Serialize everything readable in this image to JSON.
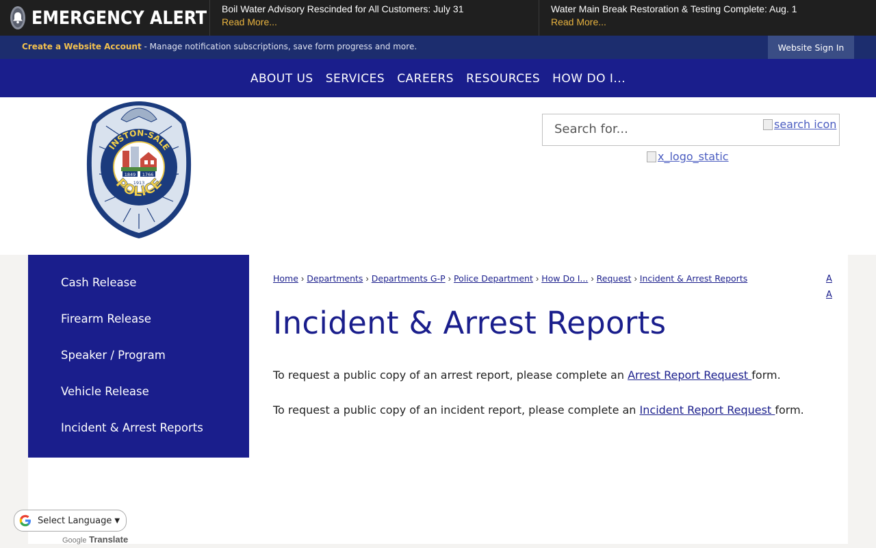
{
  "alert": {
    "title": "EMERGENCY ALERT",
    "items": [
      {
        "text": "Boil Water Advisory Rescinded for All Customers: July 31",
        "more": "Read More..."
      },
      {
        "text": "Water Main Break Restoration & Testing Complete: Aug. 1",
        "more": "Read More..."
      }
    ]
  },
  "account": {
    "create_link": "Create a Website Account",
    "description": " - Manage notification subscriptions, save form progress and more.",
    "signin": "Website Sign In"
  },
  "nav": {
    "items": [
      "ABOUT US",
      "SERVICES",
      "CAREERS",
      "RESOURCES",
      "HOW DO I..."
    ]
  },
  "header": {
    "badge": {
      "top_text": "WINSTON-SALEM",
      "bottom_text": "POLICE",
      "years": [
        "1849",
        "1766",
        "1913"
      ]
    },
    "search_placeholder": "Search for...",
    "search_icon_alt": "search icon",
    "x_logo_alt": "x_logo_static"
  },
  "sidebar": {
    "items": [
      "Cash Release",
      "Firearm Release",
      "Speaker / Program",
      "Vehicle Release",
      "Incident & Arrest Reports"
    ]
  },
  "breadcrumb": [
    "Home",
    "Departments",
    "Departments G-P",
    "Police Department",
    "How Do I...",
    "Request",
    "Incident & Arrest Reports"
  ],
  "font_resize": [
    "A",
    "A"
  ],
  "page": {
    "title": "Incident & Arrest Reports",
    "para1": {
      "before": "To request a public copy of an arrest report, please complete an ",
      "link": "Arrest Report Request ",
      "after": "form."
    },
    "para2": {
      "before": "To request a public copy of an incident report, please complete an ",
      "link": "Incident Report Request ",
      "after": "form."
    }
  },
  "translate": {
    "label": "Select Language",
    "powered_prefix": "Google",
    "powered_suffix": "Translate"
  },
  "colors": {
    "nav_blue": "#1a1e8c",
    "account_bar": "#1c2d6e",
    "alert_bg": "#1f1f1f",
    "accent_gold": "#e8b33f"
  }
}
